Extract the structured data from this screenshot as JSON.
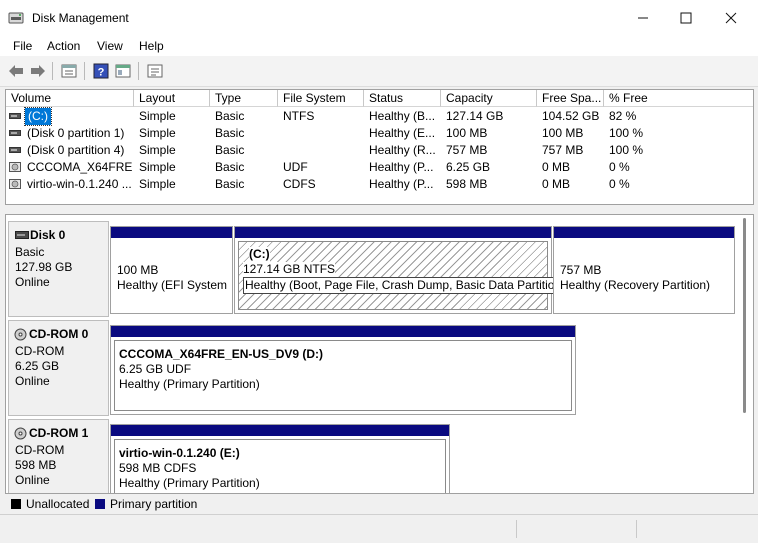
{
  "window": {
    "title": "Disk Management",
    "controls": [
      "minimize-icon",
      "maximize-icon",
      "close-icon"
    ]
  },
  "menu": {
    "items": [
      {
        "label": "File"
      },
      {
        "label": "Action"
      },
      {
        "label": "View"
      },
      {
        "label": "Help"
      }
    ]
  },
  "toolbar": {
    "icons": [
      "back-arrow-icon",
      "forward-arrow-icon",
      "properties-icon",
      "help-icon",
      "console-view-icon",
      "settings-list-icon"
    ]
  },
  "volume_list": {
    "columns": [
      {
        "label": "Volume"
      },
      {
        "label": "Layout"
      },
      {
        "label": "Type"
      },
      {
        "label": "File System"
      },
      {
        "label": "Status"
      },
      {
        "label": "Capacity"
      },
      {
        "label": "Free Spa..."
      },
      {
        "label": "% Free"
      }
    ],
    "rows": [
      {
        "icon": "volume-drive-icon",
        "volume": "(C:)",
        "layout": "Simple",
        "type": "Basic",
        "fs": "NTFS",
        "status": "Healthy (B...",
        "capacity": "127.14 GB",
        "free": "104.52 GB",
        "pct": "82 %",
        "selected": true
      },
      {
        "icon": "volume-drive-icon",
        "volume": "(Disk 0 partition 1)",
        "layout": "Simple",
        "type": "Basic",
        "fs": "",
        "status": "Healthy (E...",
        "capacity": "100 MB",
        "free": "100 MB",
        "pct": "100 %",
        "selected": false
      },
      {
        "icon": "volume-drive-icon",
        "volume": "(Disk 0 partition 4)",
        "layout": "Simple",
        "type": "Basic",
        "fs": "",
        "status": "Healthy (R...",
        "capacity": "757 MB",
        "free": "757 MB",
        "pct": "100 %",
        "selected": false
      },
      {
        "icon": "cd-drive-icon",
        "volume": "CCCOMA_X64FRE...",
        "layout": "Simple",
        "type": "Basic",
        "fs": "UDF",
        "status": "Healthy (P...",
        "capacity": "6.25 GB",
        "free": "0 MB",
        "pct": "0 %",
        "selected": false
      },
      {
        "icon": "cd-drive-icon",
        "volume": "virtio-win-0.1.240 ...",
        "layout": "Simple",
        "type": "Basic",
        "fs": "CDFS",
        "status": "Healthy (P...",
        "capacity": "598 MB",
        "free": "0 MB",
        "pct": "0 %",
        "selected": false
      }
    ]
  },
  "disks": [
    {
      "name": "Disk 0",
      "kind": "Basic",
      "size": "127.98 GB",
      "state": "Online",
      "partitions": [
        {
          "name": "",
          "size_line": "100 MB",
          "status": "Healthy (EFI System I"
        },
        {
          "name": "(C:)",
          "size_line": "127.14 GB NTFS",
          "status": "Healthy (Boot, Page File, Crash Dump, Basic Data Partition)"
        },
        {
          "name": "",
          "size_line": "757 MB",
          "status": "Healthy (Recovery Partition)"
        }
      ]
    },
    {
      "name": "CD-ROM 0",
      "kind": "CD-ROM",
      "size": "6.25 GB",
      "state": "Online",
      "partitions": [
        {
          "name": "CCCOMA_X64FRE_EN-US_DV9  (D:)",
          "size_line": "6.25 GB UDF",
          "status": "Healthy (Primary Partition)"
        }
      ]
    },
    {
      "name": "CD-ROM 1",
      "kind": "CD-ROM",
      "size": "598 MB",
      "state": "Online",
      "partitions": [
        {
          "name": "virtio-win-0.1.240  (E:)",
          "size_line": "598 MB CDFS",
          "status": "Healthy (Primary Partition)"
        }
      ]
    }
  ],
  "legend": {
    "items": [
      {
        "label": "Unallocated",
        "color": "#000000"
      },
      {
        "label": "Primary partition",
        "color": "#0a0a80"
      }
    ]
  },
  "colors": {
    "partition_header": "#0a0a80",
    "selection": "#0078d7"
  }
}
